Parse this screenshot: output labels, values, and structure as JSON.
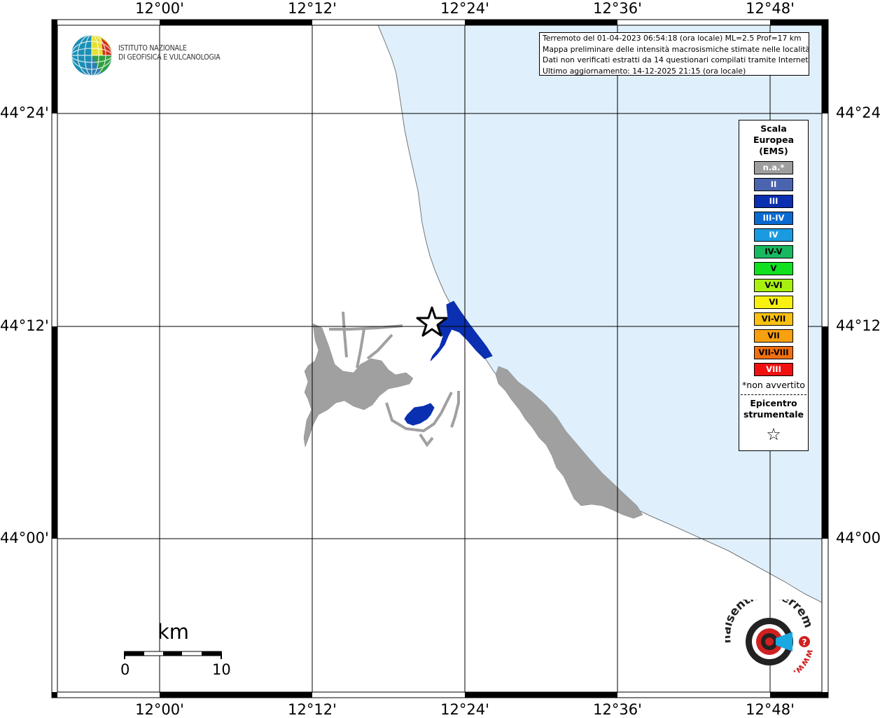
{
  "axes": {
    "top_lon_labels": [
      "12°00'",
      "12°12'",
      "12°24'",
      "12°36'",
      "12°48'"
    ],
    "bottom_lon_labels": [
      "12°00'",
      "12°12'",
      "12°24'",
      "12°36'",
      "12°48'"
    ],
    "left_lat_labels": [
      "44°24'",
      "44°12'",
      "44°00'"
    ],
    "right_lat_labels": [
      "44°24'",
      "44°12'",
      "44°00'"
    ]
  },
  "logo": {
    "line1": "ISTITUTO NAZIONALE",
    "line2": "DI GEOFISICA E VULCANOLOGIA"
  },
  "info": {
    "line1": "Terremoto del 01-04-2023 06:54:18 (ora locale) ML=2.5 Prof=17 km",
    "line2": "Mappa preliminare delle intensità macrosismiche stimate nelle località",
    "line3": "Dati non verificati estratti da 14 questionari compilati tramite Internet.",
    "line4": "Ultimo aggiornamento: 14-12-2025 21:15 (ora locale)"
  },
  "legend": {
    "title_line1": "Scala",
    "title_line2": "Europea",
    "title_line3": "(EMS)",
    "items": [
      {
        "label": "n.a.*",
        "color": "#9e9e9e",
        "text_color": "#ffffff"
      },
      {
        "label": "II",
        "color": "#4a64b0",
        "text_color": "#ffffff"
      },
      {
        "label": "III",
        "color": "#0a2fb0",
        "text_color": "#ffffff"
      },
      {
        "label": "III-IV",
        "color": "#0a6ad0",
        "text_color": "#ffffff"
      },
      {
        "label": "IV",
        "color": "#1a9ae0",
        "text_color": "#ffffff"
      },
      {
        "label": "IV-V",
        "color": "#18b860",
        "text_color": "#000000"
      },
      {
        "label": "V",
        "color": "#10e020",
        "text_color": "#000000"
      },
      {
        "label": "V-VI",
        "color": "#a8f010",
        "text_color": "#000000"
      },
      {
        "label": "VI",
        "color": "#f8f010",
        "text_color": "#000000"
      },
      {
        "label": "VI-VII",
        "color": "#f8c010",
        "text_color": "#000000"
      },
      {
        "label": "VII",
        "color": "#f8a010",
        "text_color": "#000000"
      },
      {
        "label": "VII-VIII",
        "color": "#f07010",
        "text_color": "#000000"
      },
      {
        "label": "VIII",
        "color": "#f01010",
        "text_color": "#ffffff"
      }
    ],
    "note": "*non avvertito",
    "epicentre_line1": "Epicentro",
    "epicentre_line2": "strumentale",
    "epicentre_symbol": "☆"
  },
  "scale_bar": {
    "unit": "km",
    "min_label": "0",
    "max_label": "10"
  },
  "colors": {
    "sea": "#dff0fc",
    "na_area": "#a0a0a0",
    "intensity_III": "#0a2fb0"
  },
  "badge": {
    "text": "haisentitoilterremoto.it",
    "www": "www."
  }
}
